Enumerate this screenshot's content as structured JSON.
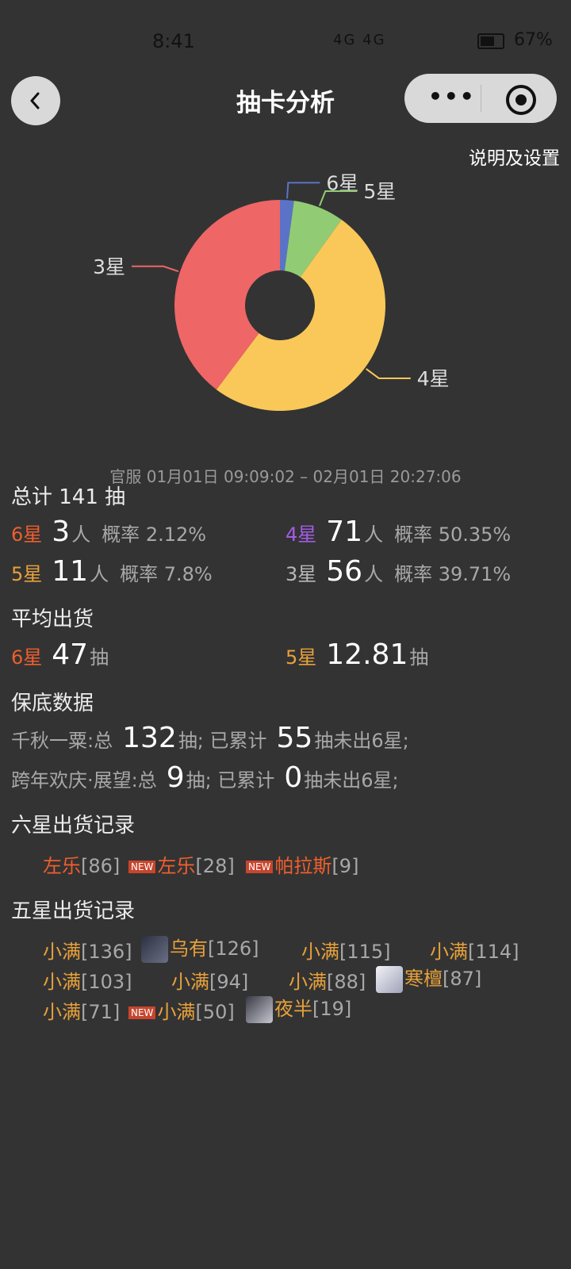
{
  "status": {
    "time": "8:41",
    "network": "4G 4G",
    "battery": "67%",
    "battery_fraction": 0.67
  },
  "header": {
    "title": "抽卡分析",
    "settings": "说明及设置"
  },
  "chart_data": {
    "type": "pie",
    "donut": true,
    "slices": [
      {
        "label": "6星",
        "value": 3,
        "color": "#5b73c6"
      },
      {
        "label": "5星",
        "value": 11,
        "color": "#91cc75"
      },
      {
        "label": "4星",
        "value": 71,
        "color": "#fac858"
      },
      {
        "label": "3星",
        "value": 56,
        "color": "#ee6666"
      }
    ]
  },
  "summary": {
    "range": "官服 01月01日 09:09:02 – 02月01日 20:27:06",
    "total_title": "总计 141 抽",
    "s6": {
      "label": "6星",
      "count": "3",
      "unit": "人",
      "prob": "概率 2.12%"
    },
    "s4": {
      "label": "4星",
      "count": "71",
      "unit": "人",
      "prob": "概率 50.35%"
    },
    "s5": {
      "label": "5星",
      "count": "11",
      "unit": "人",
      "prob": "概率 7.8%"
    },
    "s3": {
      "label": "3星",
      "count": "56",
      "unit": "人",
      "prob": "概率 39.71%"
    }
  },
  "average": {
    "title": "平均出货",
    "s6": {
      "label": "6星",
      "value": "47",
      "unit": "抽"
    },
    "s5": {
      "label": "5星",
      "value": "12.81",
      "unit": "抽"
    }
  },
  "pity": {
    "title": "保底数据",
    "rows": [
      {
        "name": "千秋一粟:总",
        "total": "132",
        "mid": "抽; 已累计",
        "count": "55",
        "tail": "抽未出6星;"
      },
      {
        "name": "跨年欢庆·展望:总",
        "total": "9",
        "mid": "抽; 已累计",
        "count": "0",
        "tail": "抽未出6星;"
      }
    ]
  },
  "six_record": {
    "title": "六星出货记录",
    "items": [
      {
        "name": "左乐",
        "num": "[86]"
      },
      {
        "badge": "NEW",
        "name": "左乐",
        "num": "[28]"
      },
      {
        "badge": "NEW",
        "name": "帕拉斯",
        "num": "[9]"
      }
    ]
  },
  "five_record": {
    "title": "五星出货记录",
    "items": [
      {
        "name": "小满",
        "num": "[136]"
      },
      {
        "name": "乌有",
        "num": "[126]"
      },
      {
        "name": "小满",
        "num": "[115]"
      },
      {
        "name": "小满",
        "num": "[114]"
      },
      {
        "name": "小满",
        "num": "[103]"
      },
      {
        "name": "小满",
        "num": "[94]"
      },
      {
        "name": "小满",
        "num": "[88]"
      },
      {
        "name": "寒檀",
        "num": "[87]"
      },
      {
        "name": "小满",
        "num": "[71]"
      },
      {
        "badge": "NEW",
        "name": "小满",
        "num": "[50]"
      },
      {
        "name": "夜半",
        "num": "[19]"
      }
    ]
  }
}
